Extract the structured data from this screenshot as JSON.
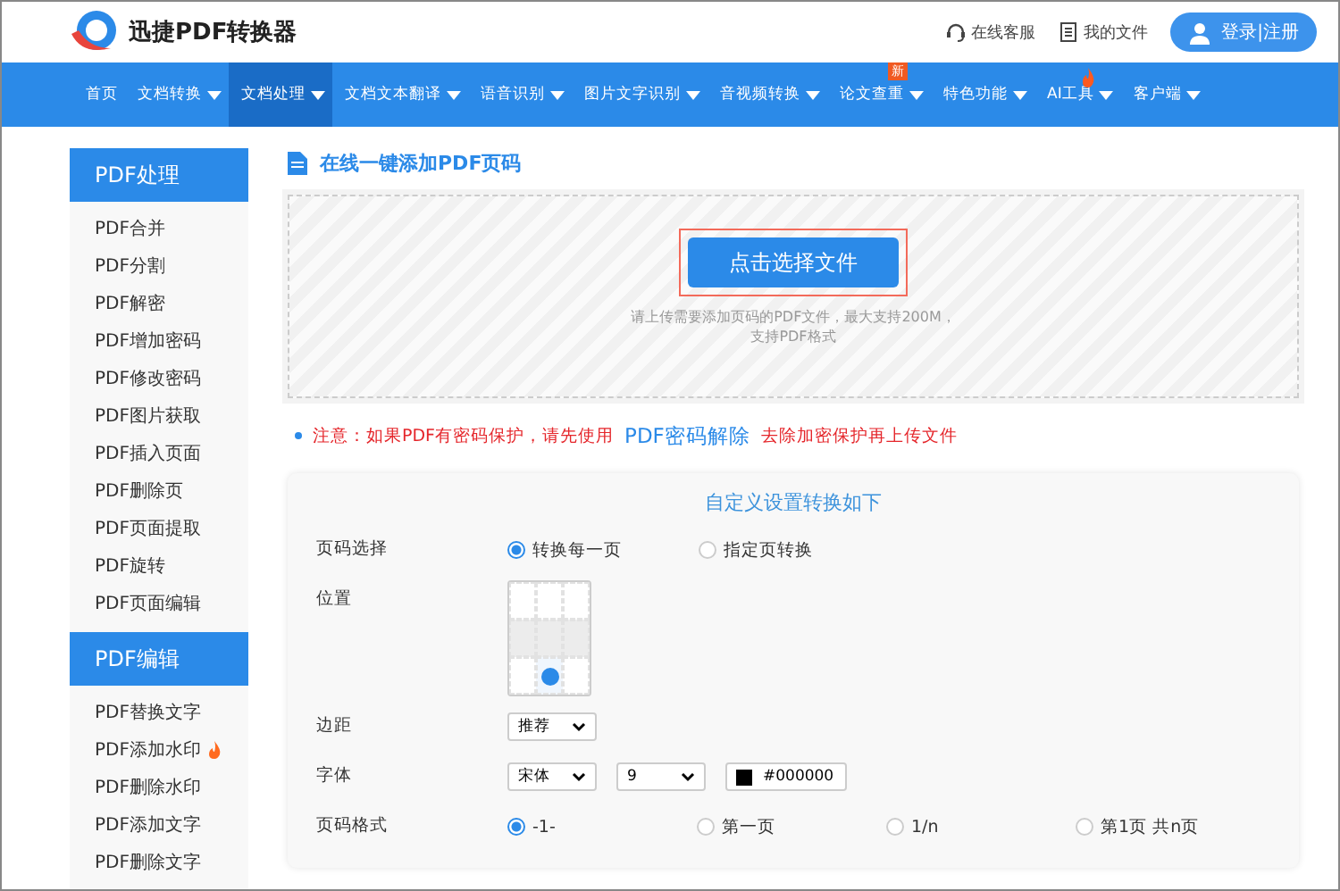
{
  "header": {
    "logo_text": "迅捷PDF转换器",
    "links": [
      {
        "kind": "service",
        "label": "在线客服"
      },
      {
        "kind": "files",
        "label": "我的文件"
      }
    ],
    "login_button": "登录|注册"
  },
  "nav": [
    {
      "label": "首页",
      "dropdown": false,
      "selected": false
    },
    {
      "label": "文档转换",
      "dropdown": true,
      "selected": false
    },
    {
      "label": "文档处理",
      "dropdown": true,
      "selected": true
    },
    {
      "label": "文档文本翻译",
      "dropdown": true,
      "selected": false
    },
    {
      "label": "语音识别",
      "dropdown": true,
      "selected": false
    },
    {
      "label": "图片文字识别",
      "dropdown": true,
      "selected": false
    },
    {
      "label": "音视频转换",
      "dropdown": true,
      "selected": false
    },
    {
      "label": "论文查重",
      "dropdown": true,
      "selected": false,
      "badge": "新"
    },
    {
      "label": "特色功能",
      "dropdown": true,
      "selected": false
    },
    {
      "label": "AI工具",
      "dropdown": true,
      "selected": false,
      "hot": true
    },
    {
      "label": "客户端",
      "dropdown": true,
      "selected": false
    }
  ],
  "sidebar": [
    {
      "title": "PDF处理",
      "items": [
        {
          "label": "PDF合并",
          "hot": false
        },
        {
          "label": "PDF分割",
          "hot": false
        },
        {
          "label": "PDF解密",
          "hot": false
        },
        {
          "label": "PDF增加密码",
          "hot": false
        },
        {
          "label": "PDF修改密码",
          "hot": false
        },
        {
          "label": "PDF图片获取",
          "hot": false
        },
        {
          "label": "PDF插入页面",
          "hot": false
        },
        {
          "label": "PDF删除页",
          "hot": false
        },
        {
          "label": "PDF页面提取",
          "hot": false
        },
        {
          "label": "PDF旋转",
          "hot": false
        },
        {
          "label": "PDF页面编辑",
          "hot": false
        }
      ]
    },
    {
      "title": "PDF编辑",
      "items": [
        {
          "label": "PDF替换文字",
          "hot": false
        },
        {
          "label": "PDF添加水印",
          "hot": true
        },
        {
          "label": "PDF删除水印",
          "hot": false
        },
        {
          "label": "PDF添加文字",
          "hot": false
        },
        {
          "label": "PDF删除文字",
          "hot": false
        }
      ]
    }
  ],
  "main": {
    "title": "在线一键添加PDF页码",
    "upload": {
      "button": "点击选择文件",
      "hint_lines": [
        "请上传需要添加页码的PDF文件，最大支持200M，",
        "支持PDF格式"
      ]
    },
    "notice": {
      "before": "注意：如果PDF有密码保护，请先使用",
      "link": "PDF密码解除",
      "after": "去除加密保护再上传文件"
    },
    "settings": {
      "title": "自定义设置转换如下",
      "rows": [
        {
          "kind": "radio",
          "label": "页码选择",
          "options": [
            {
              "label": "转换每一页",
              "selected": true
            },
            {
              "label": "指定页转换",
              "selected": false
            }
          ]
        },
        {
          "kind": "grid",
          "label": "位置",
          "cells": [
            {
              "selected": false
            },
            {
              "selected": false
            },
            {
              "selected": false
            },
            {
              "selected": false
            },
            {
              "selected": false
            },
            {
              "selected": false
            },
            {
              "selected": false
            },
            {
              "selected": true
            },
            {
              "selected": false
            }
          ]
        },
        {
          "kind": "select",
          "label": "边距",
          "selects": [
            "推荐"
          ]
        },
        {
          "kind": "font",
          "label": "字体",
          "selects": [
            "宋体",
            "9"
          ],
          "color": "#000000"
        },
        {
          "kind": "radio",
          "label": "页码格式",
          "options": [
            {
              "label": "-1-",
              "selected": true
            },
            {
              "label": "第一页",
              "selected": false
            },
            {
              "label": "1/n",
              "selected": false
            },
            {
              "label": "第1页 共n页",
              "selected": false
            }
          ]
        }
      ]
    }
  }
}
